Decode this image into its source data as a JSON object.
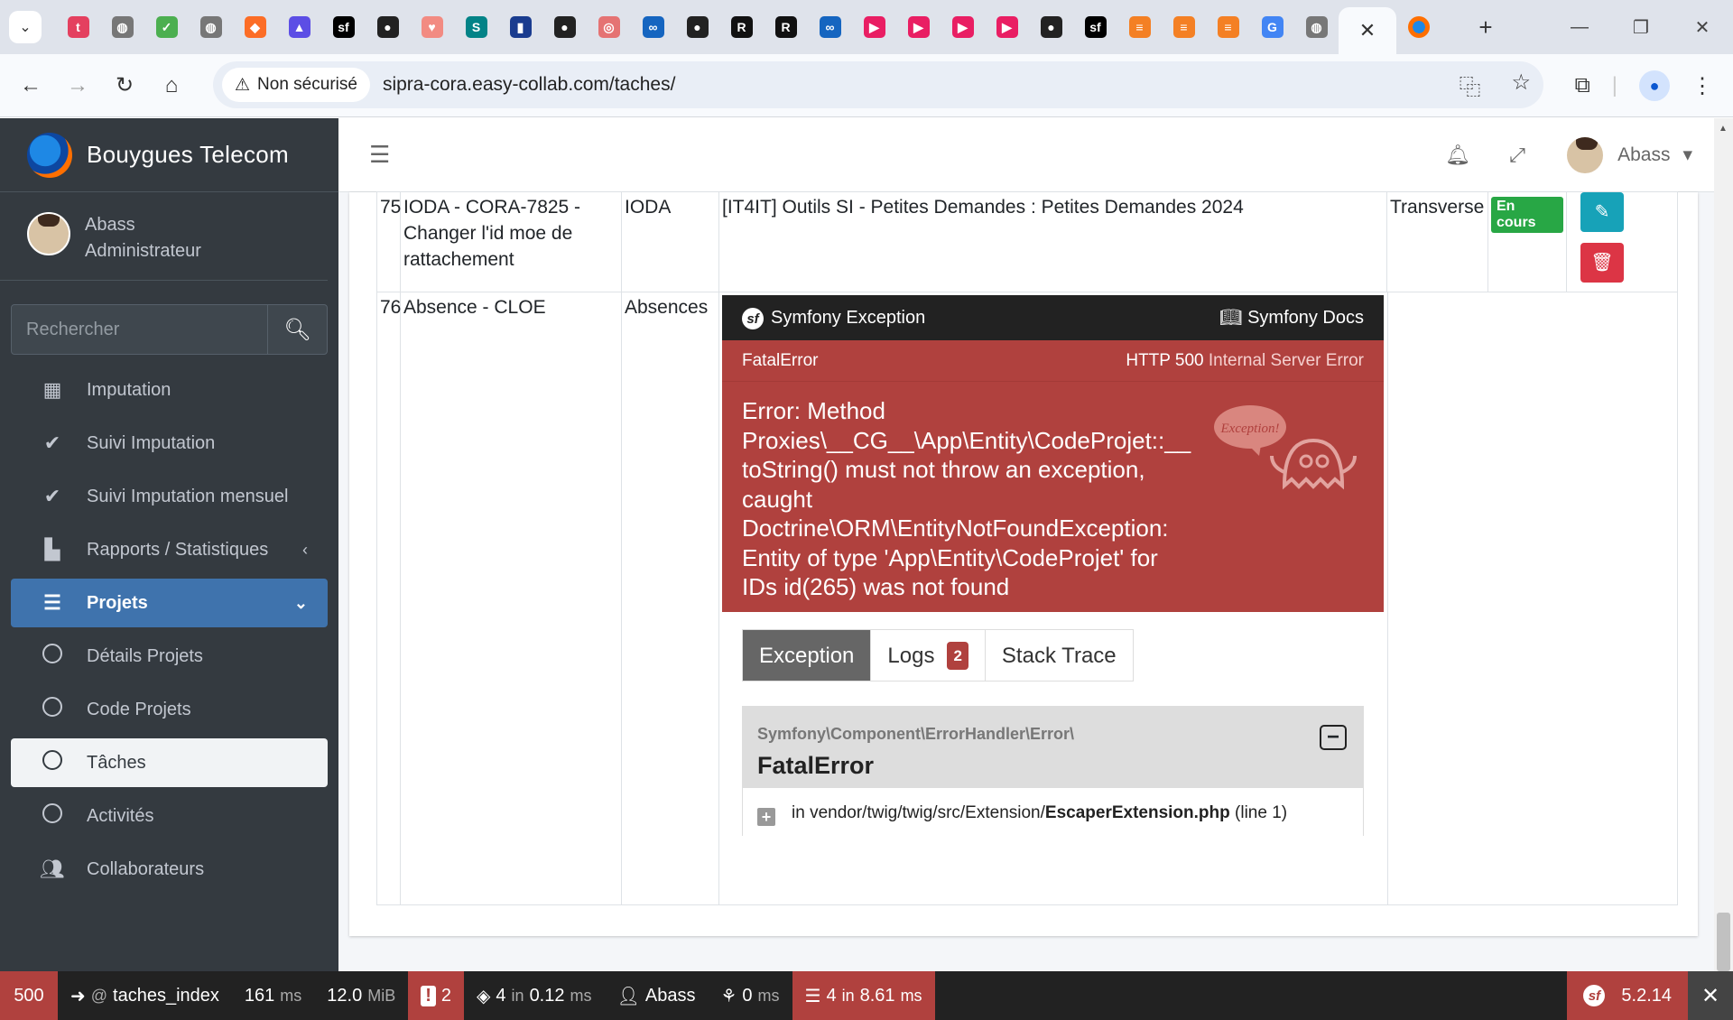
{
  "browser": {
    "tabs_favicons": [
      {
        "icon": "t-icon",
        "color": "#e4405f",
        "glyph": "t"
      },
      {
        "icon": "globe-icon",
        "color": "#777",
        "glyph": "◍"
      },
      {
        "icon": "check-app-icon",
        "color": "#4caf50",
        "glyph": "✓"
      },
      {
        "icon": "globe-icon",
        "color": "#777",
        "glyph": "◍"
      },
      {
        "icon": "gitlab-icon",
        "color": "#fc6d26",
        "glyph": "◆"
      },
      {
        "icon": "triangle-app-icon",
        "color": "#5c4ee5",
        "glyph": "▲"
      },
      {
        "icon": "symfony-icon",
        "color": "#000",
        "glyph": "sf"
      },
      {
        "icon": "github-icon",
        "color": "#222",
        "glyph": "●"
      },
      {
        "icon": "heart-app-icon",
        "color": "#f28b82",
        "glyph": "♥"
      },
      {
        "icon": "sharepoint-icon",
        "color": "#038387",
        "glyph": "S"
      },
      {
        "icon": "flag-icon",
        "color": "#1a3c8f",
        "glyph": "▮"
      },
      {
        "icon": "github-icon",
        "color": "#222",
        "glyph": "●"
      },
      {
        "icon": "circle-app-icon",
        "color": "#e57373",
        "glyph": "◎"
      },
      {
        "icon": "glasses-icon",
        "color": "#1565c0",
        "glyph": "∞"
      },
      {
        "icon": "github-icon",
        "color": "#222",
        "glyph": "●"
      },
      {
        "icon": "r-icon",
        "color": "#111",
        "glyph": "R"
      },
      {
        "icon": "r-icon",
        "color": "#111",
        "glyph": "R"
      },
      {
        "icon": "glasses-icon",
        "color": "#1565c0",
        "glyph": "∞"
      },
      {
        "icon": "play-icon",
        "color": "#e91e63",
        "glyph": "▶"
      },
      {
        "icon": "play-icon",
        "color": "#e91e63",
        "glyph": "▶"
      },
      {
        "icon": "play-icon",
        "color": "#e91e63",
        "glyph": "▶"
      },
      {
        "icon": "play-icon",
        "color": "#e91e63",
        "glyph": "▶"
      },
      {
        "icon": "github-icon",
        "color": "#222",
        "glyph": "●"
      },
      {
        "icon": "symfony-icon",
        "color": "#000",
        "glyph": "sf"
      },
      {
        "icon": "stack-icon",
        "color": "#f48024",
        "glyph": "≡"
      },
      {
        "icon": "stack-icon",
        "color": "#f48024",
        "glyph": "≡"
      },
      {
        "icon": "stack-icon",
        "color": "#f48024",
        "glyph": "≡"
      },
      {
        "icon": "google-icon",
        "color": "#4285f4",
        "glyph": "G"
      },
      {
        "icon": "globe-icon",
        "color": "#777",
        "glyph": "◍"
      }
    ],
    "security_label": "Non sécurisé",
    "url": "sipra-cora.easy-collab.com/taches/"
  },
  "sidebar": {
    "brand": "Bouygues Telecom",
    "user_name": "Abass",
    "user_role": "Administrateur",
    "search_placeholder": "Rechercher",
    "items": [
      {
        "label": "Imputation",
        "icon": "calendar-check-icon"
      },
      {
        "label": "Suivi Imputation",
        "icon": "check-icon"
      },
      {
        "label": "Suivi Imputation mensuel",
        "icon": "double-check-icon"
      },
      {
        "label": "Rapports / Statistiques",
        "icon": "bar-chart-icon"
      },
      {
        "label": "Projets",
        "icon": "tasks-icon"
      },
      {
        "label": "Détails Projets",
        "icon": "circle-icon"
      },
      {
        "label": "Code Projets",
        "icon": "circle-icon"
      },
      {
        "label": "Tâches",
        "icon": "circle-icon"
      },
      {
        "label": "Activités",
        "icon": "circle-icon"
      },
      {
        "label": "Collaborateurs",
        "icon": "users-icon"
      }
    ]
  },
  "topnav": {
    "user_name": "Abass"
  },
  "table": {
    "row75": {
      "id": "75",
      "name": "IODA - CORA-7825 - Changer l'id moe de rattachement",
      "project": "IODA",
      "code": "[IT4IT] Outils SI - Petites Demandes : Petites Demandes 2024",
      "type": "Transverse",
      "status": "En cours"
    },
    "row76": {
      "id": "76",
      "name": "Absence - CLOE",
      "project": "Absences"
    }
  },
  "exception": {
    "header_title": "Symfony Exception",
    "docs_label": "Symfony Docs",
    "error_class": "FatalError",
    "http_code": "HTTP 500",
    "http_text": "Internal Server Error",
    "message": "Error: Method Proxies\\__CG__\\App\\Entity\\CodeProjet::__toString() must not throw an exception, caught Doctrine\\ORM\\EntityNotFoundException: Entity of type 'App\\Entity\\CodeProjet' for IDs id(265) was not found",
    "ghost_label": "Exception!",
    "tabs": {
      "exception": "Exception",
      "logs": "Logs",
      "logs_count": "2",
      "stack": "Stack Trace"
    },
    "trace_namespace": "Symfony\\Component\\ErrorHandler\\Error\\",
    "trace_class": "FatalError",
    "trace_in": "in vendor/twig/twig/src/Extension/",
    "trace_file": "EscaperExtension.php",
    "trace_line": "(line 1)"
  },
  "debug_toolbar": {
    "status": "500",
    "route": "taches_index",
    "time": "161",
    "time_unit": "ms",
    "memory": "12.0",
    "memory_unit": "MiB",
    "errors": "2",
    "cache_count": "4",
    "cache_in": "in",
    "cache_time": "0.12",
    "cache_unit": "ms",
    "user": "Abass",
    "twig_time": "0",
    "twig_unit": "ms",
    "db_count": "4",
    "db_in": "in",
    "db_time": "8.61",
    "db_unit": "ms",
    "version": "5.2.14"
  }
}
